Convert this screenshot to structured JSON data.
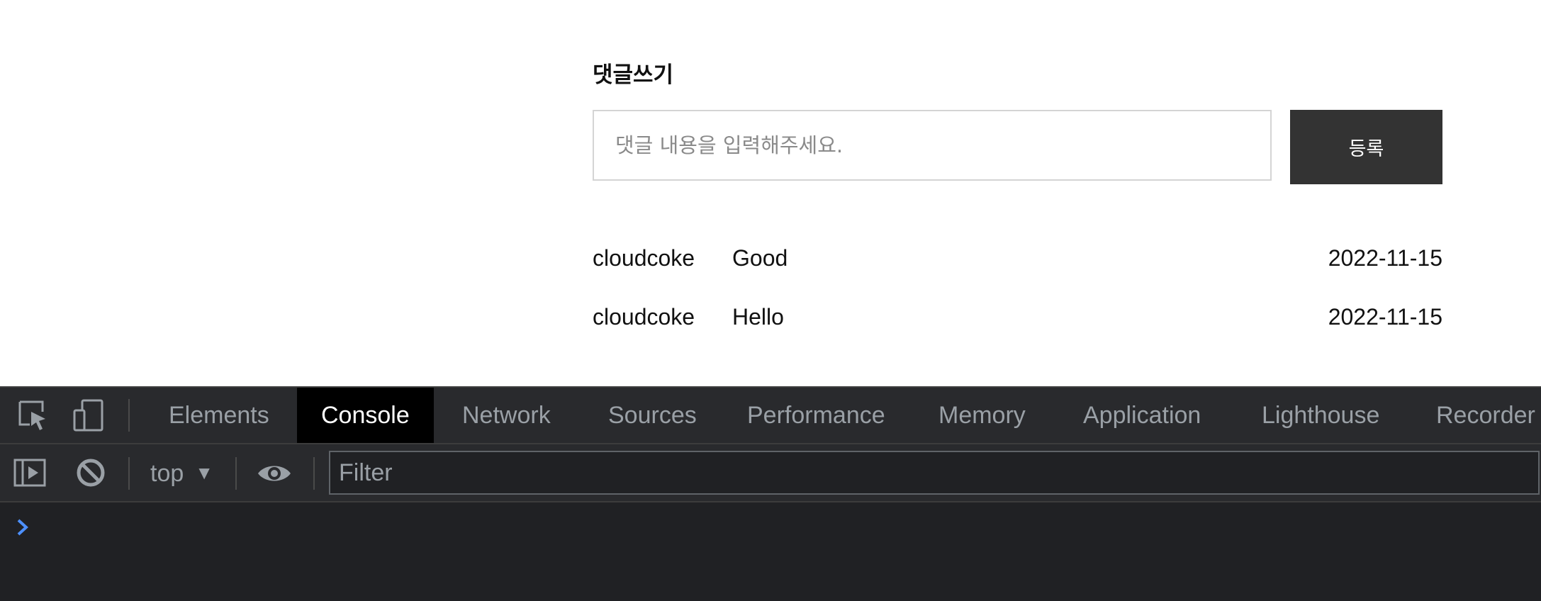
{
  "comments_section": {
    "title": "댓글쓰기",
    "input_placeholder": "댓글 내용을 입력해주세요.",
    "input_value": "",
    "submit_label": "등록",
    "comments": [
      {
        "author": "cloudcoke",
        "content": "Good",
        "date": "2022-11-15"
      },
      {
        "author": "cloudcoke",
        "content": "Hello",
        "date": "2022-11-15"
      }
    ]
  },
  "devtools": {
    "icons": [
      "inspect-element-icon",
      "device-toolbar-icon"
    ],
    "tabs": [
      {
        "label": "Elements",
        "active": false
      },
      {
        "label": "Console",
        "active": true
      },
      {
        "label": "Network",
        "active": false
      },
      {
        "label": "Sources",
        "active": false
      },
      {
        "label": "Performance",
        "active": false
      },
      {
        "label": "Memory",
        "active": false
      },
      {
        "label": "Application",
        "active": false
      },
      {
        "label": "Lighthouse",
        "active": false
      },
      {
        "label": "Recorder",
        "active": false
      }
    ],
    "toolbar": {
      "sidebar_icon": "console-sidebar-icon",
      "clear_icon": "clear-console-icon",
      "context": "top",
      "eye_icon": "live-expression-eye-icon",
      "filter_placeholder": "Filter",
      "filter_value": ""
    },
    "console": {
      "prompt_icon": "console-prompt-chevron-icon",
      "accent_color": "#4d90fe"
    }
  }
}
